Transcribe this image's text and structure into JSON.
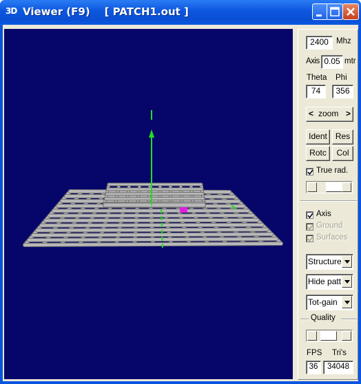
{
  "window": {
    "icon_text": "3D",
    "title": "Viewer (F9)    [ PATCH1.out ]"
  },
  "controls": {
    "frequency_value": "2400",
    "frequency_unit": "Mhz",
    "axis_label": "Axis",
    "axis_value": "0.05",
    "axis_unit": "mtr",
    "theta_label": "Theta",
    "phi_label": "Phi",
    "theta_value": "74",
    "phi_value": "356",
    "zoom_left": "<",
    "zoom_label": "zoom",
    "zoom_right": ">",
    "ident_label": "Ident",
    "res_label": "Res",
    "rotc_label": "Rotc",
    "col_label": "Col",
    "true_rad_label": "True rad.",
    "true_rad_checked": true,
    "axis_check_label": "Axis",
    "axis_checked": true,
    "ground_label": "Ground",
    "ground_checked": true,
    "ground_enabled": false,
    "surfaces_label": "Surfaces",
    "surfaces_checked": true,
    "surfaces_enabled": false,
    "structure_select": "Structure",
    "pattern_select": "Hide patt.",
    "gain_select": "Tot-gain",
    "quality_label": "Quality",
    "fps_label": "FPS",
    "tris_label": "Tri's",
    "fps_value": "36",
    "tris_value": "34048"
  },
  "colors": {
    "viewport_bg": "#06066a",
    "grid": "#b8b8b8",
    "axis": "#22dd22",
    "marker": "#e020e0"
  },
  "icons": [
    "3d-app-icon",
    "minimize-icon",
    "maximize-icon",
    "close-icon",
    "checkmark-icon",
    "chevron-down-icon",
    "slider-left-arrow-icon",
    "slider-right-arrow-icon"
  ]
}
